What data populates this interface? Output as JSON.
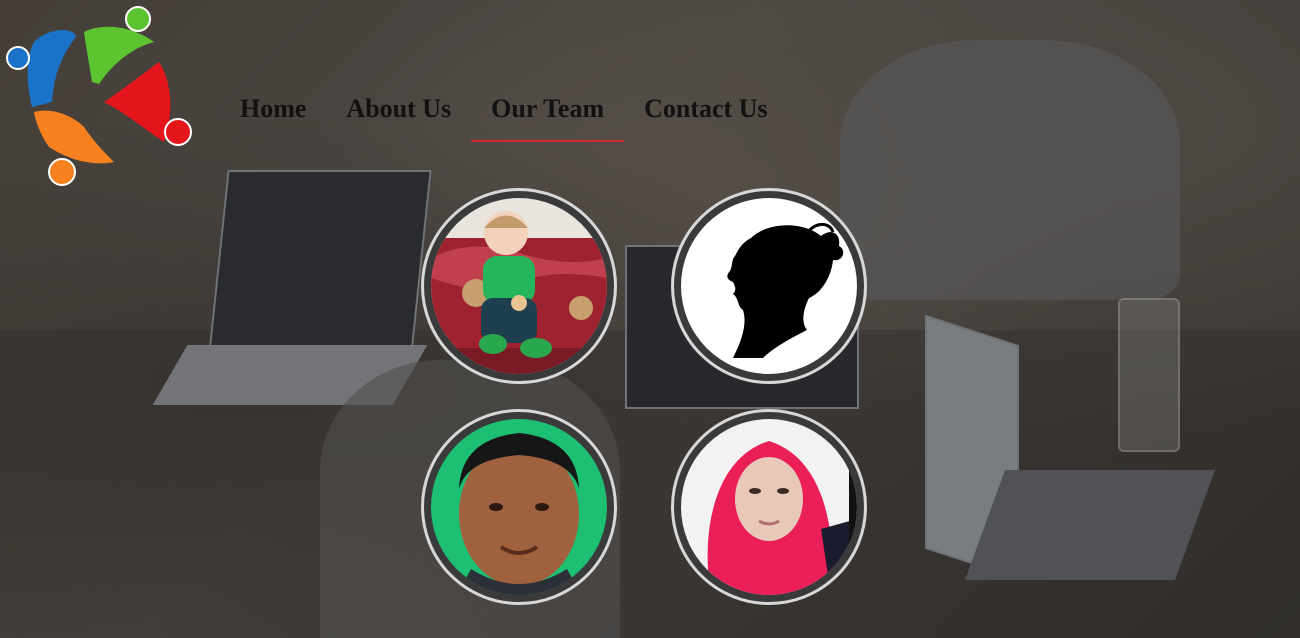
{
  "nav": {
    "items": [
      {
        "label": "Home"
      },
      {
        "label": "About Us"
      },
      {
        "label": "Our Team",
        "active": true
      },
      {
        "label": "Contact Us"
      }
    ]
  },
  "team": [
    {
      "photo": "toddler-photo"
    },
    {
      "photo": "silhouette-placeholder-icon"
    },
    {
      "photo": "man-photo"
    },
    {
      "photo": "woman-hijab-photo"
    }
  ],
  "colors": {
    "active_underline": "#d22a2a",
    "logo_blue": "#1a73c9",
    "logo_green": "#5cc430",
    "logo_red": "#e4161b",
    "logo_orange": "#f7811e"
  }
}
